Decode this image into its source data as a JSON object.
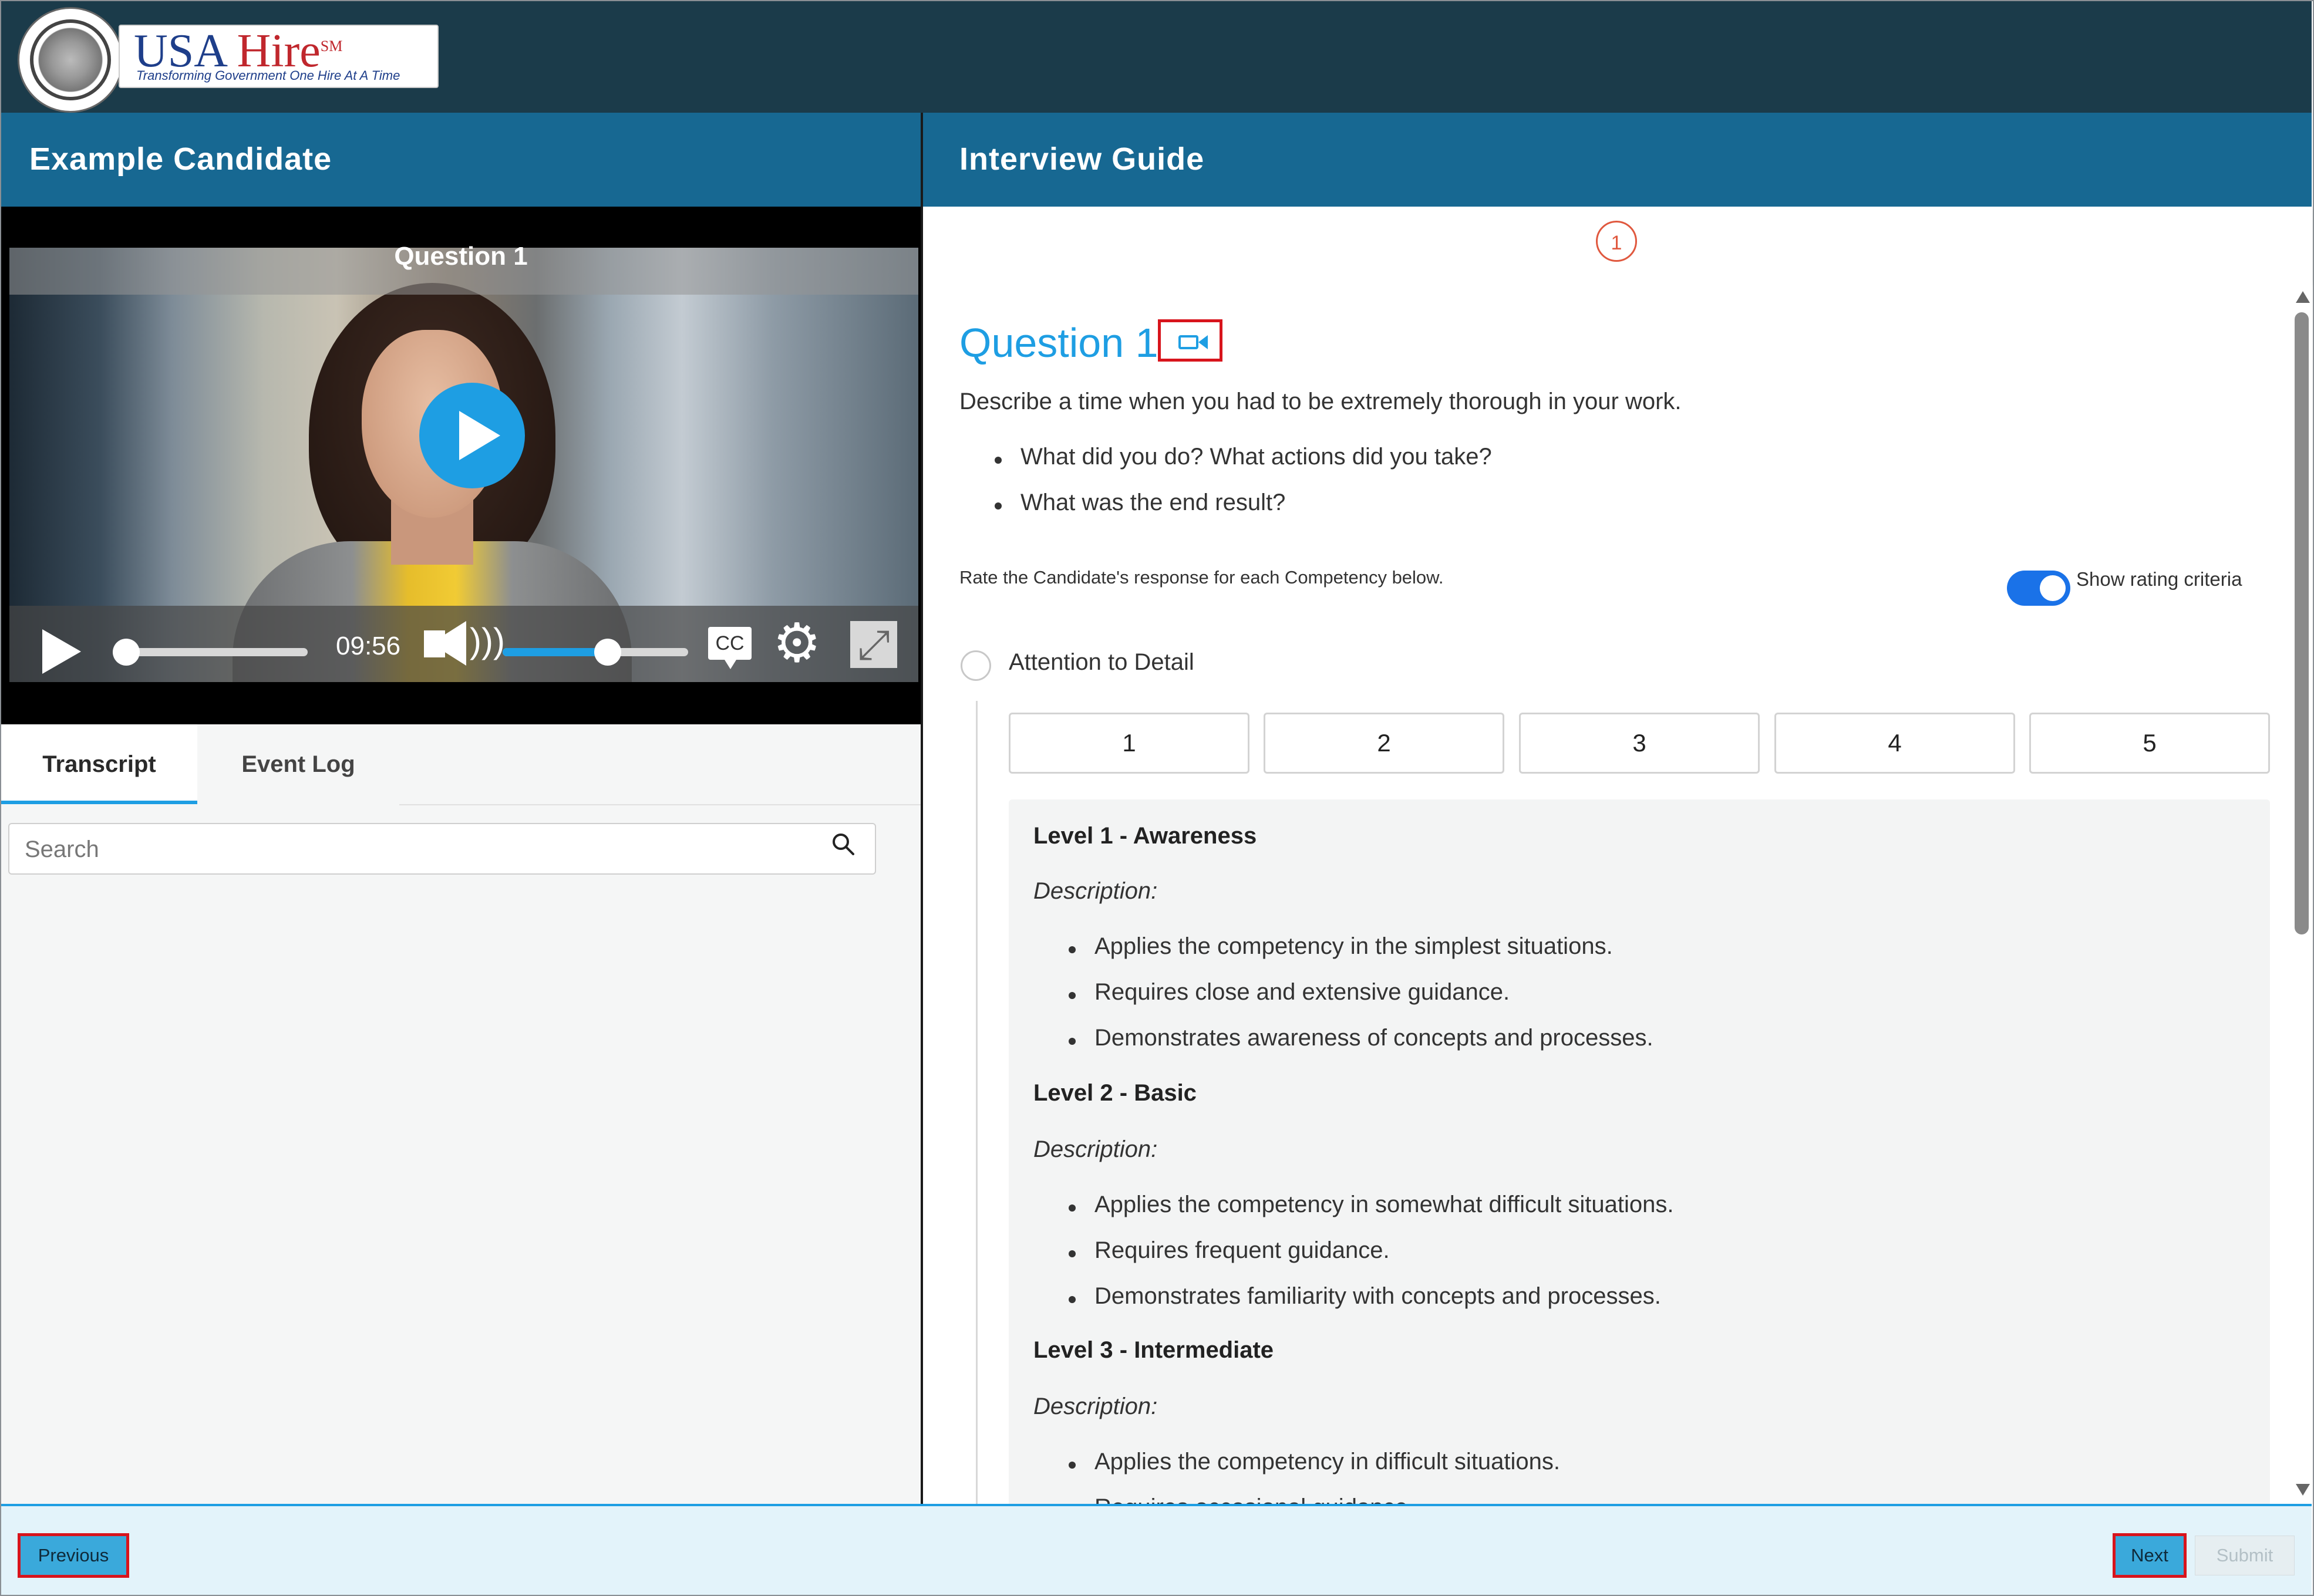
{
  "brand": {
    "logo_main": "USA Hire",
    "logo_usa": "USA",
    "logo_hire": "Hire",
    "logo_sm": "SM",
    "tagline": "Transforming Government One Hire At A Time"
  },
  "left_header": {
    "title": "Example Candidate"
  },
  "right_header": {
    "title": "Interview Guide"
  },
  "video": {
    "title": "Question 1",
    "time": "09:56",
    "seek_progress": 0,
    "volume_level": 0.55,
    "cc_label": "CC"
  },
  "tabs": [
    {
      "label": "Transcript",
      "active": true
    },
    {
      "label": "Event Log",
      "active": false
    }
  ],
  "search": {
    "placeholder": "Search",
    "value": ""
  },
  "stepper": {
    "current": "1"
  },
  "question": {
    "title": "Question 1",
    "text": "Describe a time when you had to be extremely thorough in your work.",
    "bullets": [
      "What did you do? What actions did you take?",
      "What was the end result?"
    ]
  },
  "rating": {
    "instruction": "Rate the Candidate's response for each Competency below.",
    "toggle_label": "Show rating criteria",
    "toggle_on": true,
    "competency": "Attention to Detail",
    "scale": [
      "1",
      "2",
      "3",
      "4",
      "5"
    ]
  },
  "criteria": [
    {
      "level": "Level 1 - Awareness",
      "desc_label": "Description:",
      "items": [
        "Applies the competency in the simplest situations.",
        "Requires close and extensive guidance.",
        "Demonstrates awareness of concepts and processes."
      ]
    },
    {
      "level": "Level 2 - Basic",
      "desc_label": "Description:",
      "items": [
        "Applies the competency in somewhat difficult situations.",
        "Requires frequent guidance.",
        "Demonstrates familiarity with concepts and processes."
      ]
    },
    {
      "level": "Level 3 - Intermediate",
      "desc_label": "Description:",
      "items": [
        "Applies the competency in difficult situations.",
        "Requires occasional guidance."
      ]
    }
  ],
  "footer": {
    "previous": "Previous",
    "next": "Next",
    "submit": "Submit"
  },
  "colors": {
    "topbar": "#1b3b4a",
    "header": "#176892",
    "accent": "#1e9ee3",
    "highlight_border": "#d8141c",
    "step": "#e0583e"
  }
}
